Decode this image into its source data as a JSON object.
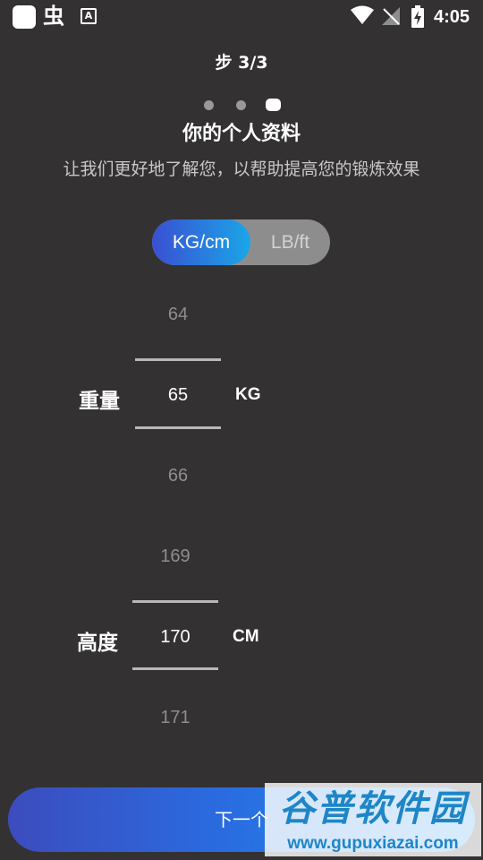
{
  "status_bar": {
    "app_icon": "app-square-icon",
    "bug_glyph": "虫",
    "a_glyph": "A",
    "time": "4:05"
  },
  "header": {
    "step": "步 3/3",
    "title": "你的个人资料",
    "subtitle": "让我们更好地了解您，以帮助提高您的锻炼效果"
  },
  "pager": {
    "total": 3,
    "current": 3
  },
  "units": {
    "options": [
      "KG/cm",
      "LB/ft"
    ],
    "selected": "KG/cm"
  },
  "weight": {
    "label": "重量",
    "prev": "64",
    "value": "65",
    "next": "66",
    "unit": "KG"
  },
  "height": {
    "label": "高度",
    "prev": "169",
    "value": "170",
    "next": "171",
    "unit": "CM"
  },
  "footer": {
    "next_label": "下一个"
  },
  "watermark": {
    "brand": "谷普软件园",
    "url": "www.gupuxiazai.com"
  },
  "colors": {
    "background": "#333132",
    "accent_start": "#3a4fd2",
    "accent_end": "#1aa6e8"
  }
}
